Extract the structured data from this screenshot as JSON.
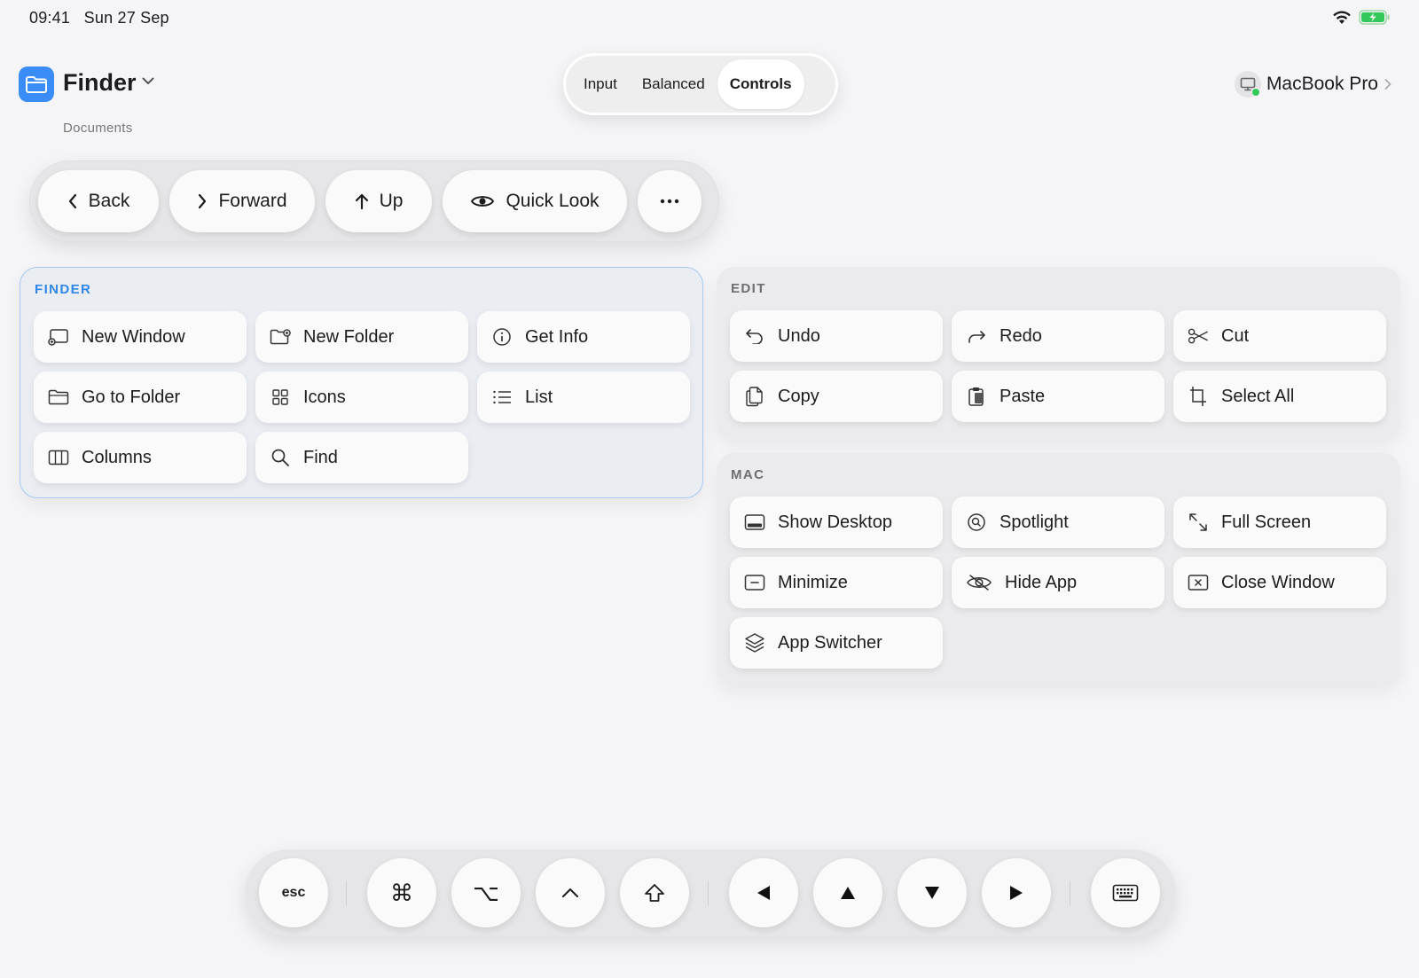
{
  "status_bar": {
    "time": "09:41",
    "date": "Sun 27 Sep"
  },
  "app": {
    "name": "Finder",
    "path": "Documents",
    "icon": "folder-icon"
  },
  "mode_segments": [
    {
      "label": "Input",
      "active": false
    },
    {
      "label": "Balanced",
      "active": false
    },
    {
      "label": "Controls",
      "active": true
    }
  ],
  "device": {
    "name": "MacBook Pro",
    "icon": "display-icon",
    "status_color": "#34c759"
  },
  "toolbar": {
    "back": "Back",
    "forward": "Forward",
    "up": "Up",
    "quick_look": "Quick Look"
  },
  "panels": {
    "finder": {
      "title": "FINDER",
      "buttons": [
        "New Window",
        "New Folder",
        "Get Info",
        "Go to Folder",
        "Icons",
        "List",
        "Columns",
        "Find"
      ]
    },
    "edit": {
      "title": "EDIT",
      "buttons": [
        "Undo",
        "Redo",
        "Cut",
        "Copy",
        "Paste",
        "Select All"
      ]
    },
    "mac": {
      "title": "MAC",
      "buttons": [
        "Show Desktop",
        "Spotlight",
        "Full Screen",
        "Minimize",
        "Hide App",
        "Close Window",
        "App Switcher"
      ]
    }
  },
  "keys": {
    "esc": "esc",
    "command": "⌘",
    "option": "⌥",
    "control": "^",
    "shift": "⇧"
  },
  "colors": {
    "accent": "#3a8df6",
    "selected_panel_title": "#2f86e8",
    "battery": "#34c759"
  }
}
